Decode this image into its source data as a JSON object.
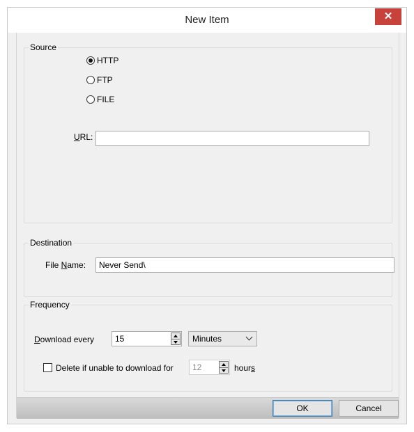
{
  "window": {
    "title": "New Item",
    "close_glyph": "✕"
  },
  "source": {
    "legend": "Source",
    "options": [
      {
        "label": "HTTP",
        "checked": true
      },
      {
        "label": "FTP",
        "checked": false
      },
      {
        "label": "FILE",
        "checked": false
      }
    ],
    "url_label_mnemonic": "U",
    "url_label_rest": "RL:",
    "url_value": ""
  },
  "destination": {
    "legend": "Destination",
    "file_label_pre": "File ",
    "file_label_mnemonic": "N",
    "file_label_post": "ame:",
    "file_value": "Never Send\\"
  },
  "frequency": {
    "legend": "Frequency",
    "download_label_mnemonic": "D",
    "download_label_rest": "ownload every",
    "download_value": "15",
    "unit_value": "Minutes",
    "delete_checked": false,
    "delete_label": "Delete if unable to download for",
    "delete_value": "12",
    "hours_label_pre": "hour",
    "hours_label_mnemonic": "s"
  },
  "buttons": {
    "ok": "OK",
    "cancel": "Cancel"
  },
  "icons": {
    "close": "close-icon",
    "spin": "spin-arrows-icon",
    "dropdown": "chevron-down-icon"
  }
}
